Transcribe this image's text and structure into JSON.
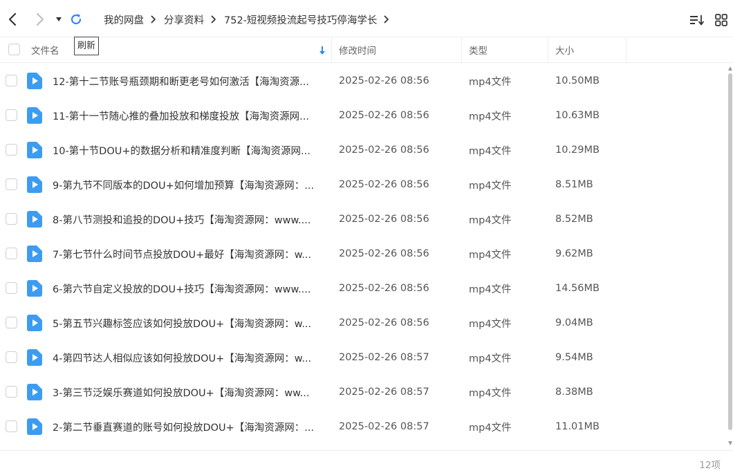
{
  "breadcrumb": [
    {
      "label": "我的网盘"
    },
    {
      "label": "分享资料"
    },
    {
      "label": "752-短视频投流起号技巧停海学长"
    }
  ],
  "tooltip": "刷新",
  "columns": {
    "name": "文件名",
    "modified": "修改时间",
    "type": "类型",
    "size": "大小"
  },
  "files": [
    {
      "name": "12-第十二节账号瓶颈期和断更老号如何激活【海淘资源...",
      "modified": "2025-02-26 08:56",
      "type": "mp4文件",
      "size": "10.50MB"
    },
    {
      "name": "11-第十一节随心推的叠加投放和梯度投放【海淘资源网...",
      "modified": "2025-02-26 08:56",
      "type": "mp4文件",
      "size": "10.63MB"
    },
    {
      "name": "10-第十节DOU+的数据分析和精准度判断【海淘资源网...",
      "modified": "2025-02-26 08:56",
      "type": "mp4文件",
      "size": "10.29MB"
    },
    {
      "name": "9-第九节不同版本的DOU+如何增加预算【海淘资源网：...",
      "modified": "2025-02-26 08:56",
      "type": "mp4文件",
      "size": "8.51MB"
    },
    {
      "name": "8-第八节测投和追投的DOU+技巧【海淘资源网：www....",
      "modified": "2025-02-26 08:56",
      "type": "mp4文件",
      "size": "8.52MB"
    },
    {
      "name": "7-第七节什么时间节点投放DOU+最好【海淘资源网：w...",
      "modified": "2025-02-26 08:56",
      "type": "mp4文件",
      "size": "9.62MB"
    },
    {
      "name": "6-第六节自定义投放的DOU+技巧【海淘资源网：www....",
      "modified": "2025-02-26 08:56",
      "type": "mp4文件",
      "size": "14.56MB"
    },
    {
      "name": "5-第五节兴趣标签应该如何投放DOU+【海淘资源网：w...",
      "modified": "2025-02-26 08:56",
      "type": "mp4文件",
      "size": "9.04MB"
    },
    {
      "name": "4-第四节达人相似应该如何投放DOU+【海淘资源网：w...",
      "modified": "2025-02-26 08:57",
      "type": "mp4文件",
      "size": "9.54MB"
    },
    {
      "name": "3-第三节泛娱乐赛道如何投放DOU+【海淘资源网：ww...",
      "modified": "2025-02-26 08:57",
      "type": "mp4文件",
      "size": "8.38MB"
    },
    {
      "name": "2-第二节垂直赛道的账号如何投放DOU+【海淘资源网：...",
      "modified": "2025-02-26 08:57",
      "type": "mp4文件",
      "size": "11.01MB"
    }
  ],
  "footer": {
    "count": "12项"
  },
  "colors": {
    "accent": "#2f86f6",
    "file_icon": "#3d9cf0",
    "refresh": "#2f86f6"
  }
}
